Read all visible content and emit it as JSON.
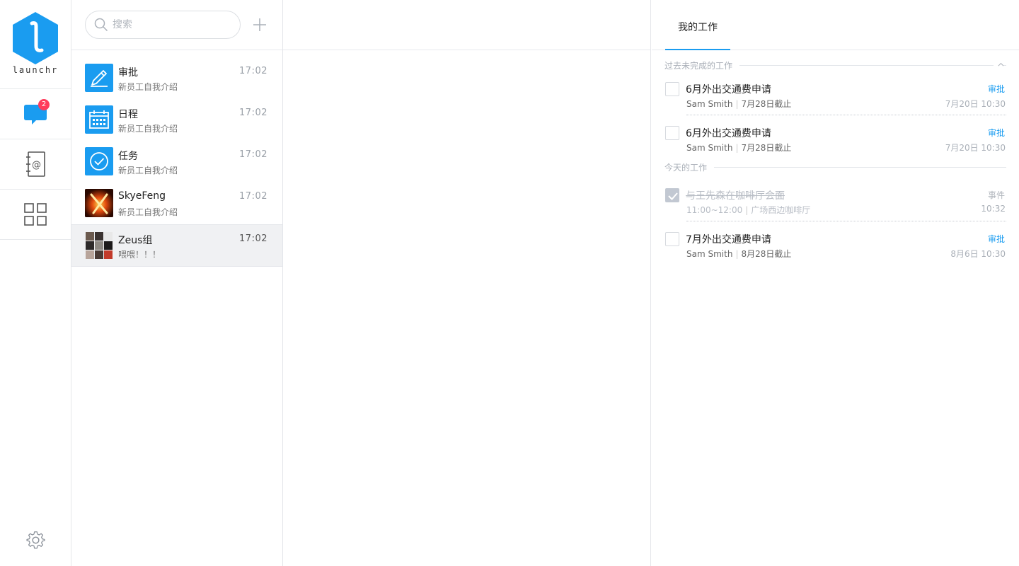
{
  "app": {
    "logo_text": "launchr",
    "brand_color": "#1a9cf0",
    "unread_badge": "2"
  },
  "rail": {
    "items": [
      {
        "icon": "chat-bubble-icon"
      },
      {
        "icon": "contacts-book-icon"
      },
      {
        "icon": "apps-grid-icon"
      }
    ],
    "settings_icon": "gear-icon"
  },
  "search": {
    "placeholder": "搜索"
  },
  "conversations": [
    {
      "name": "审批",
      "time": "17:02",
      "preview": "新员工自我介绍",
      "avatar": "approval-pen-icon"
    },
    {
      "name": "日程",
      "time": "17:02",
      "preview": "新员工自我介绍",
      "avatar": "calendar-icon"
    },
    {
      "name": "任务",
      "time": "17:02",
      "preview": "新员工自我介绍",
      "avatar": "task-check-icon"
    },
    {
      "name": "SkyeFeng",
      "time": "17:02",
      "preview": "新员工自我介绍",
      "avatar": "user-photo"
    },
    {
      "name": "Zeus组",
      "time": "17:02",
      "preview": "喂喂！！！",
      "avatar": "group-photo-grid"
    }
  ],
  "work": {
    "tab_label": "我的工作",
    "section_past": "过去未完成的工作",
    "section_today": "今天的工作",
    "past_tasks": [
      {
        "title": "6月外出交通费申请",
        "person": "Sam Smith",
        "deadline": "7月28日截止",
        "kind": "审批",
        "when": "7月20日 10:30"
      },
      {
        "title": "6月外出交通费申请",
        "person": "Sam Smith",
        "deadline": "7月28日截止",
        "kind": "审批",
        "when": "7月20日 10:30"
      }
    ],
    "today_tasks": [
      {
        "title": "与王先森在咖啡厅会面",
        "person": "11:00~12:00",
        "deadline": "广场西边咖啡厅",
        "kind": "事件",
        "when": "10:32",
        "done": true
      },
      {
        "title": "7月外出交通费申请",
        "person": "Sam Smith",
        "deadline": "8月28日截止",
        "kind": "审批",
        "when": "8月6日 10:30",
        "done": false
      }
    ]
  }
}
